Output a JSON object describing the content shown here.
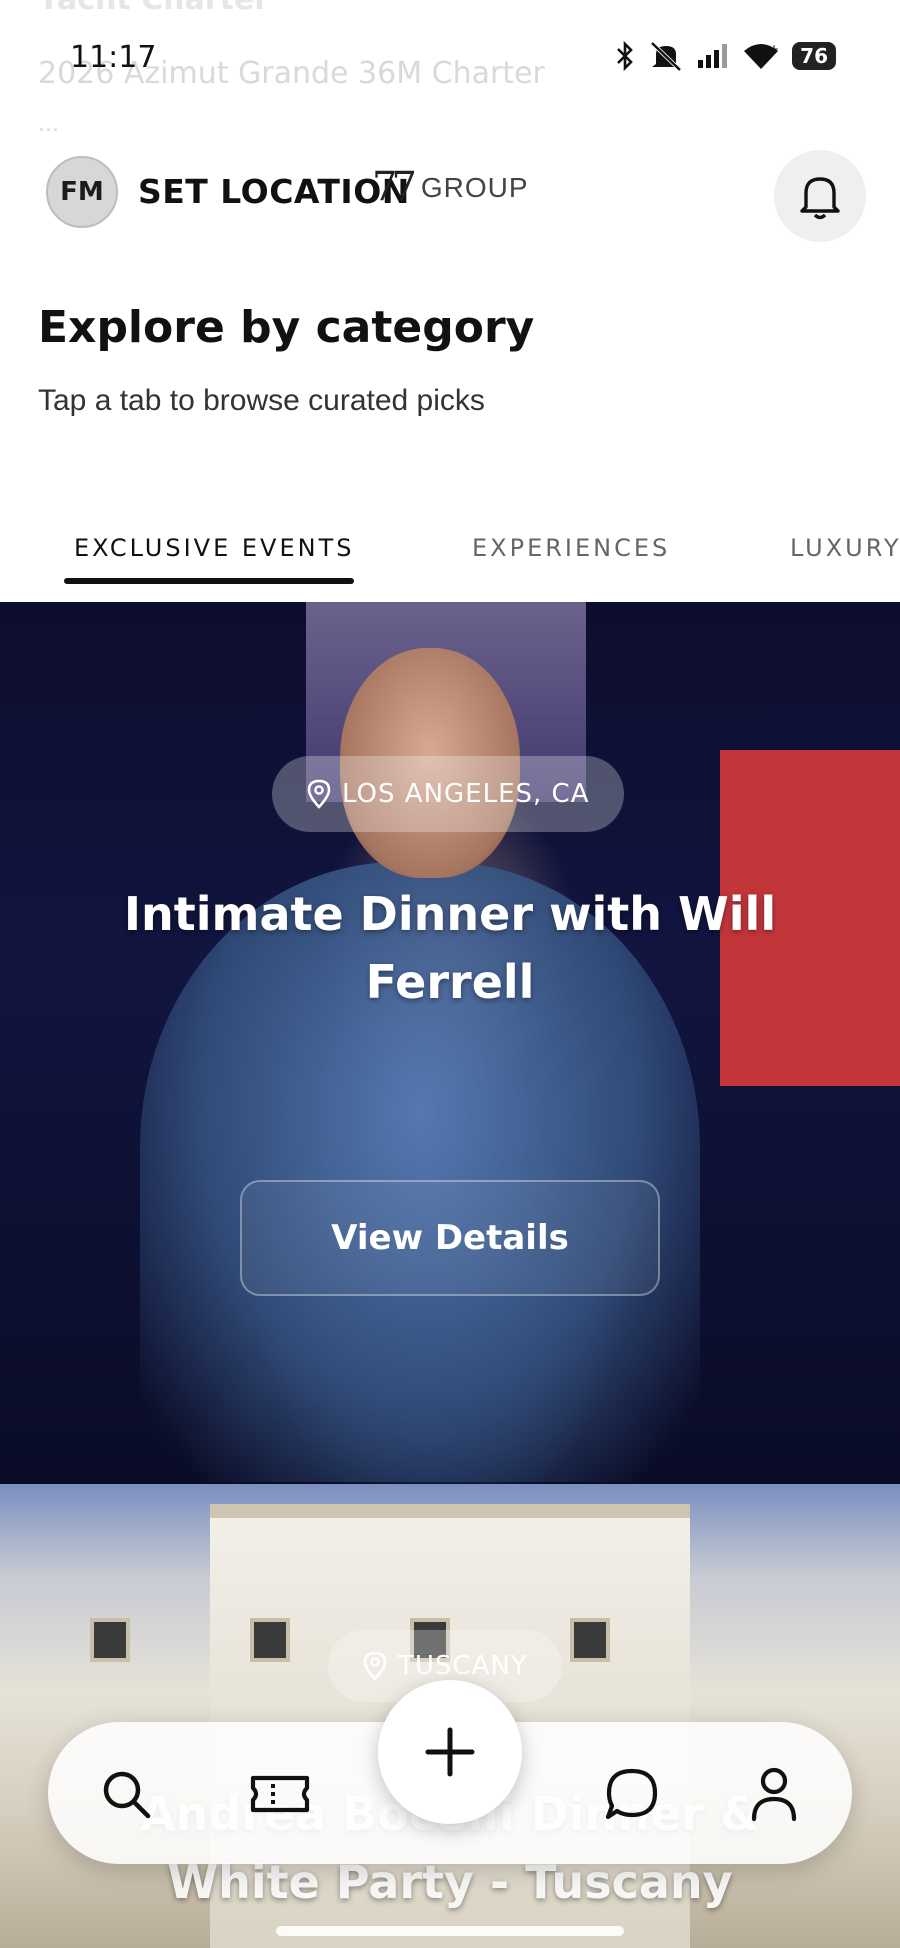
{
  "background_ghost": {
    "title": "Yacht Charter",
    "subtitle": "2026 Azimut Grande 36M Charter",
    "ellipsis": "..."
  },
  "status_bar": {
    "time": "11:17",
    "battery": "76",
    "icons": [
      "bluetooth-icon",
      "silent-icon",
      "signal-icon",
      "wifi-icon",
      "battery-icon"
    ]
  },
  "header": {
    "avatar_initials": "FM",
    "location_label": "SET LOCATION",
    "brand_mark": "77",
    "brand_group": "GROUP"
  },
  "intro": {
    "title": "Explore by category",
    "subtitle": "Tap a tab to browse curated picks"
  },
  "tabs": [
    {
      "label": "EXCLUSIVE EVENTS",
      "active": true
    },
    {
      "label": "EXPERIENCES",
      "active": false
    },
    {
      "label": "LUXURY",
      "active": false
    }
  ],
  "cards": [
    {
      "location": "LOS ANGELES, CA",
      "title": "Intimate Dinner with Will Ferrell",
      "button": "View Details"
    },
    {
      "location": "TUSCANY",
      "title": "Andrea Bocelli Dinner & White Party - Tuscany"
    }
  ],
  "bottom_nav": [
    "search-icon",
    "ticket-icon",
    "add-icon",
    "chat-icon",
    "profile-icon"
  ],
  "colors": {
    "accent_dark": "#111111",
    "tab_inactive": "#666666",
    "card_overlay_pill": "rgba(255,255,255,0.28)"
  }
}
